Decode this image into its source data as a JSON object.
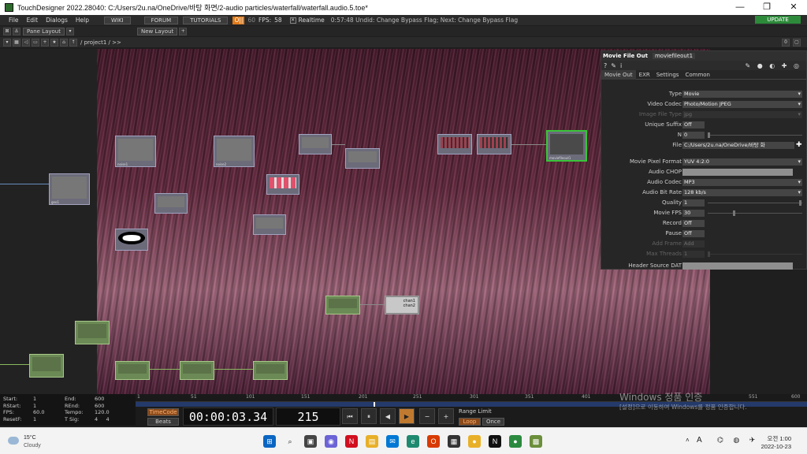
{
  "window": {
    "title": "TouchDesigner 2022.28040: C:/Users/2u.na/OneDrive/바탕 화면/2-audio  particles/waterfall/waterfall.audio.5.toe*",
    "controls": [
      "—",
      "❐",
      "✕"
    ]
  },
  "menubar": {
    "items": [
      "File",
      "Edit",
      "Dialogs",
      "Help"
    ],
    "buttons": [
      "WIKI",
      "FORUM",
      "TUTORIALS"
    ],
    "perf_label": "O||",
    "fps_cap": "60",
    "fps_label": "FPS:",
    "fps_value": "58",
    "realtime_label": "Realtime",
    "realtime_checked": "✕",
    "status": "0:57:48 Undid: Change Bypass Flag; Next: Change Bypass Flag",
    "update_label": "UPDATE"
  },
  "panebar": {
    "pane_layout": "Pane Layout",
    "new_layout": "New Layout",
    "add": "+"
  },
  "pathbar": {
    "path": "/ project1 / >>",
    "right_count": "0"
  },
  "nodes": {
    "moviefileout_label": "moviefileout1",
    "text_node": [
      "chan1",
      "chan2"
    ],
    "chop_texts": [
      "chan1",
      "chan2"
    ]
  },
  "params": {
    "type_label": "Movie File Out",
    "node_name": "moviefileout1",
    "icons": [
      "?",
      "✎",
      "i"
    ],
    "tabs": [
      "Movie Out",
      "EXR",
      "Settings",
      "Common"
    ],
    "rows": [
      {
        "label": "Type",
        "value": "Movie",
        "kind": "drop"
      },
      {
        "label": "Video Codec",
        "value": "Photo/Motion JPEG",
        "kind": "drop"
      },
      {
        "label": "Image File Type",
        "value": "jpg",
        "kind": "drop",
        "disabled": true
      },
      {
        "label": "Unique Suffix",
        "value": "Off",
        "kind": "tog"
      },
      {
        "label": "N",
        "value": "0",
        "kind": "num"
      },
      {
        "label": "File",
        "value": "C:/Users/2u.na/OneDrive/바탕 화",
        "kind": "file"
      },
      {
        "label": "Movie Pixel Format",
        "value": "YUV 4:2:0",
        "kind": "drop"
      },
      {
        "label": "Audio CHOP",
        "value": "",
        "kind": "field"
      },
      {
        "label": "Audio Codec",
        "value": "MP3",
        "kind": "drop"
      },
      {
        "label": "Audio Bit Rate",
        "value": "128 kb/s",
        "kind": "drop"
      },
      {
        "label": "Quality",
        "value": "1",
        "kind": "num"
      },
      {
        "label": "Movie FPS",
        "value": "30",
        "kind": "num"
      },
      {
        "label": "Record",
        "value": "Off",
        "kind": "tog"
      },
      {
        "label": "Pause",
        "value": "Off",
        "kind": "tog"
      },
      {
        "label": "Add Frame",
        "value": "Add",
        "kind": "tog",
        "disabled": true
      },
      {
        "label": "Max Threads",
        "value": "1",
        "kind": "num",
        "disabled": true
      },
      {
        "label": "Header Source DAT",
        "value": "",
        "kind": "field"
      }
    ]
  },
  "stats": {
    "start_label": "Start:",
    "start_value": "1",
    "end_label": "End:",
    "end_value": "600",
    "rstart_label": "RStart:",
    "rstart_value": "1",
    "rend_label": "REnd:",
    "rend_value": "600",
    "fps_label": "FPS:",
    "fps_value": "60.0",
    "tempo_label": "Tempo:",
    "tempo_value": "120.0",
    "resetf_label": "ResetF:",
    "resetf_value": "1",
    "tsig_label": "T Sig:",
    "tsig_value": "4     4"
  },
  "ruler": {
    "ticks": [
      "1",
      "51",
      "101",
      "151",
      "201",
      "251",
      "301",
      "351",
      "401",
      "551",
      "600"
    ]
  },
  "timeline": {
    "timecode_label": "TimeCode",
    "beats_label": "Beats",
    "time": "00:00:03.34",
    "frame": "215",
    "range_label": "Range Limit",
    "loop_label": "Loop",
    "once_label": "Once",
    "buttons": [
      "⏮",
      "⏸",
      "◀",
      "▶",
      "−",
      "+"
    ]
  },
  "watermark": {
    "title": "Windows 정품 인증",
    "subtitle": "[설정]으로 이동하여 Windows를 정품 인증합니다."
  },
  "taskbar": {
    "temp": "15°C",
    "weather": "Cloudy",
    "lang": "A",
    "time": "오전 1:00",
    "date": "2022-10-23"
  }
}
